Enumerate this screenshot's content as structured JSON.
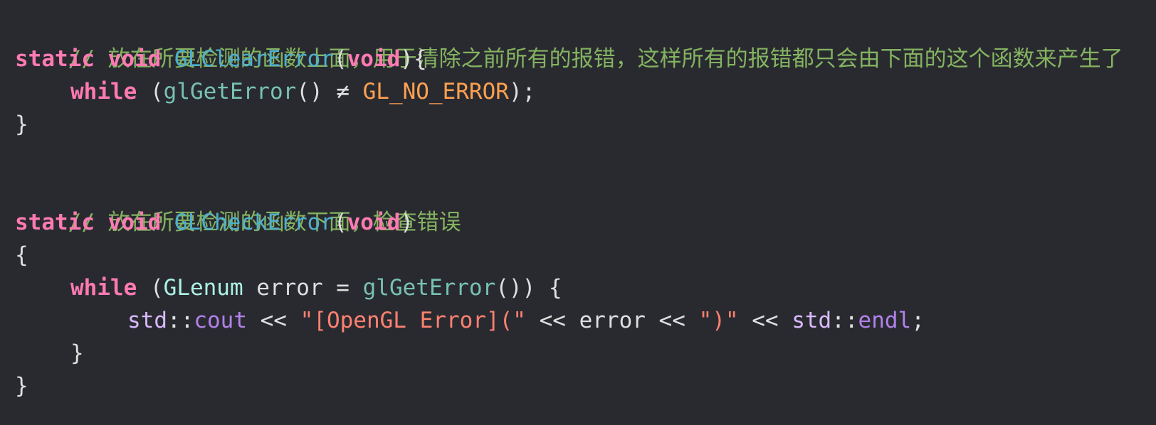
{
  "colors": {
    "background": "#292a30",
    "keyword": "#ff7ab2",
    "function_declaration": "#4eb0cc",
    "function_call": "#78c2b3",
    "macro": "#ffa14f",
    "comment": "#84b360",
    "string": "#ff8170",
    "namespace": "#dabaff",
    "library_member": "#b281eb",
    "type": "#acf2e4",
    "plain": "#dfdfe0"
  },
  "code": {
    "comment1": "// 放在所要检测的函数上面，用于清除之前所有的报错，这样所有的报错都只会由下面的这个函数来产生了",
    "clear_fn": {
      "static_kw": "static",
      "void_kw": "void",
      "name": "GLClearError",
      "open_paren": "(",
      "param_kw": "void",
      "close_paren_brace": "){",
      "while_kw": "while",
      "while_open": " (",
      "call": "glGetError",
      "call_parens": "()",
      "neq_op": " ≠ ",
      "macro": "GL_NO_ERROR",
      "while_close": ");",
      "close_brace": "}"
    },
    "comment2": "// 放在所要检测的函数下面，检查错误",
    "check_fn": {
      "static_kw": "static",
      "void_kw": "void",
      "name": "GLCheckError",
      "open_paren": "(",
      "param_kw": "void",
      "close_paren": ")",
      "open_brace": "{",
      "while_kw": "while",
      "while_open": " (",
      "type": "GLenum",
      "assign": " error = ",
      "call": "glGetError",
      "call_close": "()) {",
      "std1": "std",
      "scope1": "::",
      "cout": "cout",
      "op1": " << ",
      "str1": "\"[OpenGL Error](\"",
      "op2": " << error << ",
      "str2": "\")\"",
      "op3": " << ",
      "std2": "std",
      "scope2": "::",
      "endl": "endl",
      "semi": ";",
      "inner_close": "}",
      "close_brace": "}"
    }
  }
}
